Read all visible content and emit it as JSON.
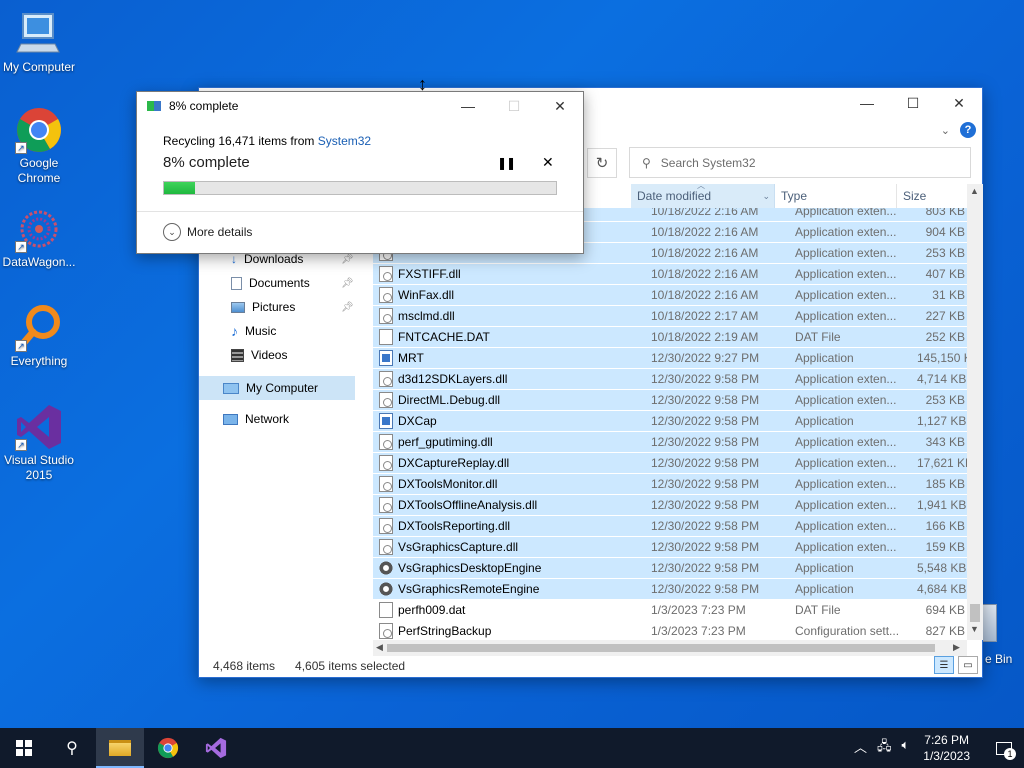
{
  "desktop": {
    "icons": [
      {
        "label": "My Computer",
        "icon": "computer-icon"
      },
      {
        "label": "Google Chrome",
        "icon": "chrome-icon"
      },
      {
        "label": "DataWagon...",
        "icon": "datawagon-icon"
      },
      {
        "label": "Everything",
        "icon": "everything-icon"
      },
      {
        "label": "Visual Studio 2015",
        "icon": "visual-studio-icon"
      }
    ],
    "recycle_bin_partial_label": "e Bin"
  },
  "progress_dialog": {
    "title": "8% complete",
    "line_prefix": "Recycling 16,471 items from ",
    "line_link": "System32",
    "big_status": "8% complete",
    "progress_percent": 8,
    "more_details_label": "More details",
    "colors": {
      "fill": "#1fb83f",
      "link": "#1a5fb4"
    }
  },
  "explorer": {
    "search_placeholder": "Search System32",
    "columns": {
      "date": "Date modified",
      "type": "Type",
      "size": "Size"
    },
    "nav": [
      {
        "label": "Downloads",
        "icon": "downloads-icon",
        "pinned": true
      },
      {
        "label": "Documents",
        "icon": "documents-icon",
        "pinned": true
      },
      {
        "label": "Pictures",
        "icon": "pictures-icon",
        "pinned": true
      },
      {
        "label": "Music",
        "icon": "music-icon",
        "pinned": false
      },
      {
        "label": "Videos",
        "icon": "videos-icon",
        "pinned": false
      },
      {
        "label": "My Computer",
        "icon": "computer-icon",
        "pinned": false,
        "selected": true
      },
      {
        "label": "Network",
        "icon": "network-icon",
        "pinned": false
      }
    ],
    "rows": [
      {
        "name": "",
        "date": "10/18/2022 2:16 AM",
        "type": "Application exten...",
        "size": "803 KB",
        "icon": "dll",
        "selected": true
      },
      {
        "name": "",
        "date": "10/18/2022 2:16 AM",
        "type": "Application exten...",
        "size": "904 KB",
        "icon": "dll",
        "selected": true
      },
      {
        "name": "",
        "date": "10/18/2022 2:16 AM",
        "type": "Application exten...",
        "size": "253 KB",
        "icon": "dll",
        "selected": true
      },
      {
        "name": "FXSTIFF.dll",
        "date": "10/18/2022 2:16 AM",
        "type": "Application exten...",
        "size": "407 KB",
        "icon": "dll",
        "selected": true
      },
      {
        "name": "WinFax.dll",
        "date": "10/18/2022 2:16 AM",
        "type": "Application exten...",
        "size": "31 KB",
        "icon": "dll",
        "selected": true
      },
      {
        "name": "msclmd.dll",
        "date": "10/18/2022 2:17 AM",
        "type": "Application exten...",
        "size": "227 KB",
        "icon": "dll",
        "selected": true
      },
      {
        "name": "FNTCACHE.DAT",
        "date": "10/18/2022 2:19 AM",
        "type": "DAT File",
        "size": "252 KB",
        "icon": "page",
        "selected": true
      },
      {
        "name": "MRT",
        "date": "12/30/2022 9:27 PM",
        "type": "Application",
        "size": "145,150 KB",
        "icon": "mrt",
        "selected": true
      },
      {
        "name": "d3d12SDKLayers.dll",
        "date": "12/30/2022 9:58 PM",
        "type": "Application exten...",
        "size": "4,714 KB",
        "icon": "dll",
        "selected": true
      },
      {
        "name": "DirectML.Debug.dll",
        "date": "12/30/2022 9:58 PM",
        "type": "Application exten...",
        "size": "253 KB",
        "icon": "dll",
        "selected": true
      },
      {
        "name": "DXCap",
        "date": "12/30/2022 9:58 PM",
        "type": "Application",
        "size": "1,127 KB",
        "icon": "app",
        "selected": true
      },
      {
        "name": "perf_gputiming.dll",
        "date": "12/30/2022 9:58 PM",
        "type": "Application exten...",
        "size": "343 KB",
        "icon": "dll",
        "selected": true
      },
      {
        "name": "DXCaptureReplay.dll",
        "date": "12/30/2022 9:58 PM",
        "type": "Application exten...",
        "size": "17,621 KB",
        "icon": "dll",
        "selected": true
      },
      {
        "name": "DXToolsMonitor.dll",
        "date": "12/30/2022 9:58 PM",
        "type": "Application exten...",
        "size": "185 KB",
        "icon": "dll",
        "selected": true
      },
      {
        "name": "DXToolsOfflineAnalysis.dll",
        "date": "12/30/2022 9:58 PM",
        "type": "Application exten...",
        "size": "1,941 KB",
        "icon": "dll",
        "selected": true
      },
      {
        "name": "DXToolsReporting.dll",
        "date": "12/30/2022 9:58 PM",
        "type": "Application exten...",
        "size": "166 KB",
        "icon": "dll",
        "selected": true
      },
      {
        "name": "VsGraphicsCapture.dll",
        "date": "12/30/2022 9:58 PM",
        "type": "Application exten...",
        "size": "159 KB",
        "icon": "dll",
        "selected": true
      },
      {
        "name": "VsGraphicsDesktopEngine",
        "date": "12/30/2022 9:58 PM",
        "type": "Application",
        "size": "5,548 KB",
        "icon": "gear",
        "selected": true
      },
      {
        "name": "VsGraphicsRemoteEngine",
        "date": "12/30/2022 9:58 PM",
        "type": "Application",
        "size": "4,684 KB",
        "icon": "gear",
        "selected": true
      },
      {
        "name": "perfh009.dat",
        "date": "1/3/2023 7:23 PM",
        "type": "DAT File",
        "size": "694 KB",
        "icon": "page",
        "selected": false
      },
      {
        "name": "PerfStringBackup",
        "date": "1/3/2023 7:23 PM",
        "type": "Configuration sett...",
        "size": "827 KB",
        "icon": "dll",
        "selected": false
      }
    ],
    "status": {
      "items": "4,468 items",
      "selected": "4,605 items selected"
    }
  },
  "taskbar": {
    "time": "7:26 PM",
    "date": "1/3/2023",
    "notification_count": "1",
    "apps": [
      "file-explorer-icon",
      "chrome-icon",
      "visual-studio-icon"
    ]
  }
}
